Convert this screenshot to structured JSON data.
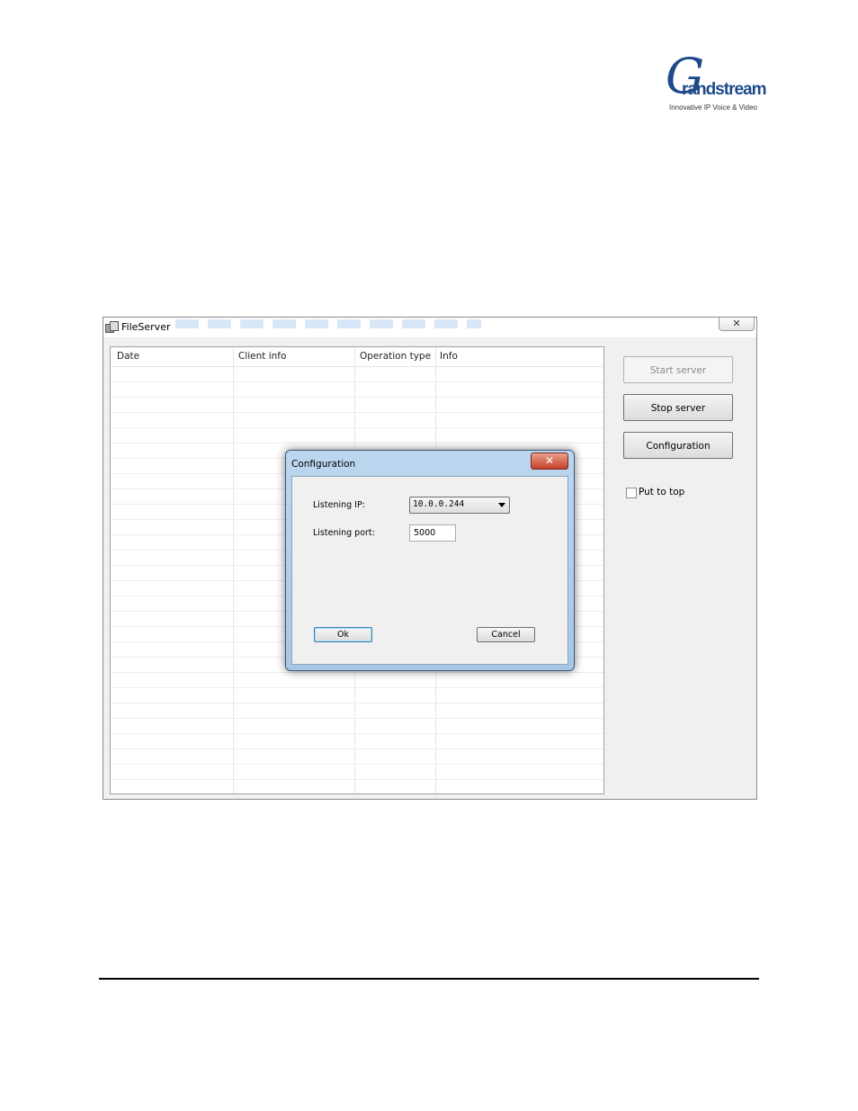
{
  "logo": {
    "letter": "G",
    "word": "randstream",
    "tagline": "Innovative IP Voice & Video"
  },
  "window": {
    "title": "FileServer",
    "close_glyph": "✕",
    "columns": [
      "Date",
      "Client info",
      "Operation type",
      "Info"
    ],
    "buttons": {
      "start": "Start server",
      "stop": "Stop server",
      "config": "Configuration"
    },
    "put_to_top": {
      "label": "Put to top",
      "checked": false
    }
  },
  "dialog": {
    "title": "Configuration",
    "close_glyph": "✕",
    "ip_label": "Listening IP:",
    "ip_value": "10.0.0.244",
    "port_label": "Listening port:",
    "port_value": "5000",
    "ok": "Ok",
    "cancel": "Cancel"
  },
  "icons": [
    "fileserver-app-icon",
    "close-icon",
    "dropdown-arrow-icon",
    "checkbox"
  ]
}
